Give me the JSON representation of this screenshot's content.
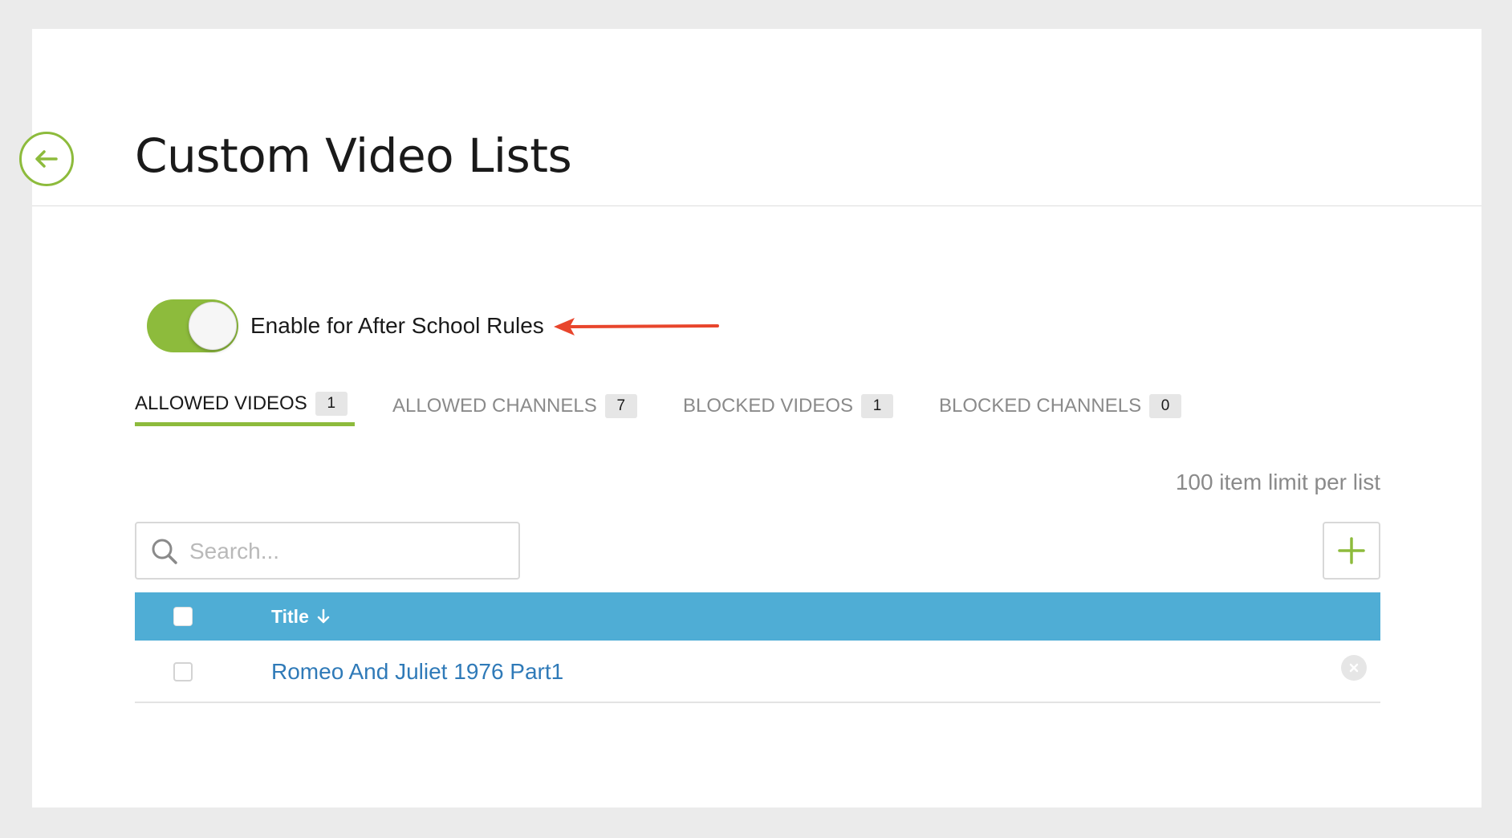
{
  "page": {
    "title": "Custom Video Lists"
  },
  "toggle": {
    "label": "Enable for After School Rules",
    "enabled": true
  },
  "tabs": [
    {
      "label": "ALLOWED VIDEOS",
      "count": "1",
      "active": true
    },
    {
      "label": "ALLOWED CHANNELS",
      "count": "7",
      "active": false
    },
    {
      "label": "BLOCKED VIDEOS",
      "count": "1",
      "active": false
    },
    {
      "label": "BLOCKED CHANNELS",
      "count": "0",
      "active": false
    }
  ],
  "limit_text": "100 item limit per list",
  "search": {
    "placeholder": "Search...",
    "value": ""
  },
  "table": {
    "header_title": "Title",
    "sort_direction": "descending",
    "rows": [
      {
        "title": "Romeo And Juliet 1976 Part1",
        "checked": false
      }
    ]
  },
  "icons": {
    "back": "arrow-left-icon",
    "search": "search-icon",
    "add": "plus-icon",
    "sort": "arrow-down-icon",
    "remove": "close-circle-icon",
    "annotation": "red-arrow-icon"
  },
  "colors": {
    "accent_green": "#8dbb3c",
    "table_header_blue": "#4fadd5",
    "link_blue": "#2f7ab8",
    "annotation_red": "#e8452c"
  }
}
